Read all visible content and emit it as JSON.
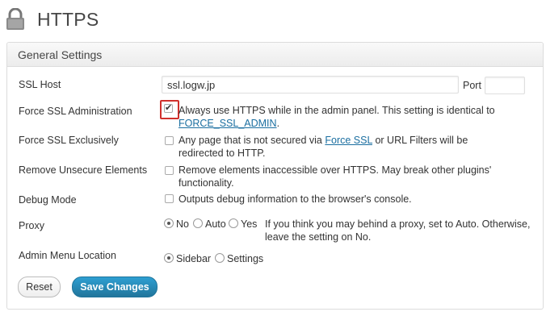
{
  "page": {
    "title": "HTTPS",
    "icon": "lock-icon"
  },
  "section": {
    "title": "General Settings"
  },
  "ssl_host": {
    "label": "SSL Host",
    "value": "ssl.logw.jp",
    "port_label": "Port",
    "port_value": ""
  },
  "force_ssl_admin": {
    "label": "Force SSL Administration",
    "checked": true,
    "desc": "Always use HTTPS while in the admin panel. This setting is identical to",
    "link": "FORCE_SSL_ADMIN",
    "suffix": "."
  },
  "force_ssl_exclusive": {
    "label": "Force SSL Exclusively",
    "checked": false,
    "desc_pre": "Any page that is not secured via",
    "link": "Force SSL",
    "desc_post": "or URL Filters will be",
    "desc_line2": "redirected to HTTP."
  },
  "remove_unsecure": {
    "label": "Remove Unsecure Elements",
    "checked": false,
    "desc_line1": "Remove elements inaccessible over HTTPS. May break other plugins'",
    "desc_line2": "functionality."
  },
  "debug_mode": {
    "label": "Debug Mode",
    "checked": false,
    "desc": "Outputs debug information to the browser's console."
  },
  "proxy": {
    "label": "Proxy",
    "options": [
      "No",
      "Auto",
      "Yes"
    ],
    "selected": "No",
    "help_line1": "If you think you may behind a proxy, set to Auto. Otherwise,",
    "help_line2": "leave the setting on No."
  },
  "admin_menu": {
    "label": "Admin Menu Location",
    "options": [
      "Sidebar",
      "Settings"
    ],
    "selected": "Sidebar"
  },
  "buttons": {
    "reset": "Reset",
    "save": "Save Changes"
  },
  "colors": {
    "primary_button": "#21759b",
    "highlight": "#d0302c",
    "link": "#1a6ea0"
  }
}
